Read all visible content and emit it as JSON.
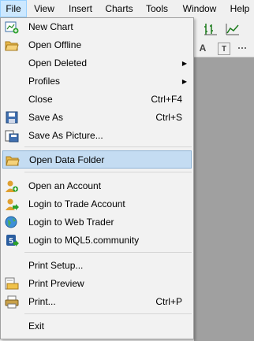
{
  "menubar": {
    "items": [
      "File",
      "View",
      "Insert",
      "Charts",
      "Tools",
      "Window",
      "Help"
    ]
  },
  "file_menu": {
    "items": [
      {
        "label": "New Chart",
        "shortcut": "",
        "icon": "new-chart-icon"
      },
      {
        "label": "Open Offline",
        "shortcut": "",
        "icon": "open-folder-icon"
      },
      {
        "label": "Open Deleted",
        "shortcut": "",
        "submenu": true
      },
      {
        "label": "Profiles",
        "shortcut": "",
        "submenu": true
      },
      {
        "label": "Close",
        "shortcut": "Ctrl+F4"
      },
      {
        "label": "Save As",
        "shortcut": "Ctrl+S",
        "icon": "save-disk-icon"
      },
      {
        "label": "Save As Picture...",
        "shortcut": "",
        "icon": "save-picture-icon"
      },
      {
        "label": "Open Data Folder",
        "shortcut": "",
        "icon": "open-folder-icon",
        "highlighted": true
      },
      {
        "label": "Open an Account",
        "shortcut": "",
        "icon": "add-account-icon"
      },
      {
        "label": "Login to Trade Account",
        "shortcut": "",
        "icon": "login-account-icon"
      },
      {
        "label": "Login to Web Trader",
        "shortcut": "",
        "icon": "globe-icon"
      },
      {
        "label": "Login to MQL5.community",
        "shortcut": "",
        "icon": "mql5-icon"
      },
      {
        "label": "Print Setup...",
        "shortcut": ""
      },
      {
        "label": "Print Preview",
        "shortcut": "",
        "icon": "print-preview-icon"
      },
      {
        "label": "Print...",
        "shortcut": "Ctrl+P",
        "icon": "printer-icon"
      },
      {
        "label": "Exit",
        "shortcut": ""
      }
    ]
  },
  "toolbar_fragment": {
    "letters": [
      "A",
      "T"
    ]
  },
  "colors": {
    "highlight_bg": "#c4dcf2",
    "highlight_border": "#8fb4d6",
    "menubar_active": "#cce8ff",
    "workspace": "#a0a0a0"
  }
}
